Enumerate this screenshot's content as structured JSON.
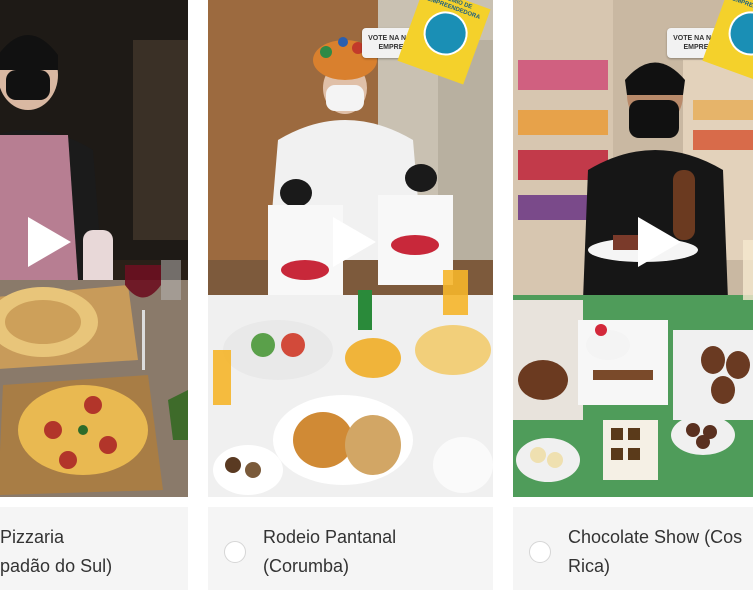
{
  "cards": [
    {
      "name_line1": "Pizzaria",
      "name_line2": "padão do Sul)",
      "has_vote_badge": false
    },
    {
      "name_line1": "Rodeio Pantanal",
      "name_line2": "(Corumba)",
      "has_vote_badge": true,
      "vote_text": "VOTE NA NOSSA EMPRESA!",
      "flag_text": "PRÊMIO DE EMPREENDEDORA"
    },
    {
      "name_line1": "Chocolate Show (Cos",
      "name_line2": "Rica)",
      "has_vote_badge": true,
      "vote_text": "VOTE NA NOSSA EMPRESA!",
      "flag_text": "PRÊMIO DE EMPREENDEDORA"
    }
  ],
  "colors": {
    "caption_bg": "#f5f5f5",
    "text": "#333333",
    "flag_yellow": "#f4d12b",
    "flag_circle": "#1a8fb5"
  },
  "icons": {
    "play": "play-icon",
    "radio": "radio-circle"
  }
}
